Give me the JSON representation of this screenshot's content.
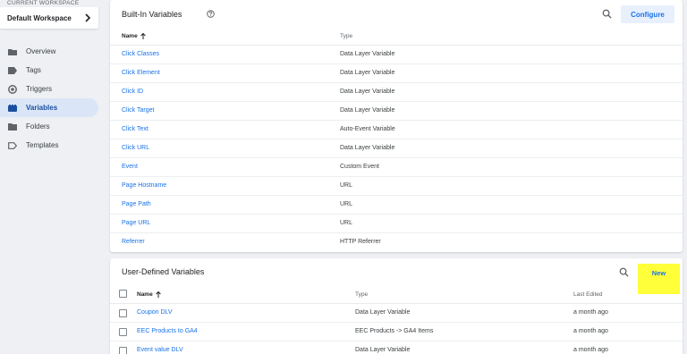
{
  "sidebar": {
    "workspace_label": "CURRENT WORKSPACE",
    "workspace_name": "Default Workspace",
    "items": [
      {
        "label": "Overview",
        "icon": "folder-icon"
      },
      {
        "label": "Tags",
        "icon": "tag-icon"
      },
      {
        "label": "Triggers",
        "icon": "trigger-icon"
      },
      {
        "label": "Variables",
        "icon": "variables-icon",
        "active": true
      },
      {
        "label": "Folders",
        "icon": "folder-icon"
      },
      {
        "label": "Templates",
        "icon": "template-icon"
      }
    ]
  },
  "builtin": {
    "title": "Built-In Variables",
    "configure_label": "Configure",
    "columns": {
      "name": "Name",
      "type": "Type"
    },
    "rows": [
      {
        "name": "Click Classes",
        "type": "Data Layer Variable"
      },
      {
        "name": "Click Element",
        "type": "Data Layer Variable"
      },
      {
        "name": "Click ID",
        "type": "Data Layer Variable"
      },
      {
        "name": "Click Target",
        "type": "Data Layer Variable"
      },
      {
        "name": "Click Text",
        "type": "Auto-Event Variable"
      },
      {
        "name": "Click URL",
        "type": "Data Layer Variable"
      },
      {
        "name": "Event",
        "type": "Custom Event"
      },
      {
        "name": "Page Hostname",
        "type": "URL"
      },
      {
        "name": "Page Path",
        "type": "URL"
      },
      {
        "name": "Page URL",
        "type": "URL"
      },
      {
        "name": "Referrer",
        "type": "HTTP Referrer"
      }
    ]
  },
  "user_defined": {
    "title": "User-Defined Variables",
    "new_label": "New",
    "columns": {
      "name": "Name",
      "type": "Type",
      "last_edited": "Last Edited"
    },
    "rows": [
      {
        "name": "Coupon DLV",
        "type": "Data Layer Variable",
        "last_edited": "a month ago"
      },
      {
        "name": "EEC Products to GA4",
        "type": "EEC Products -> GA4 Items",
        "last_edited": "a month ago"
      },
      {
        "name": "Event value DLV",
        "type": "Data Layer Variable",
        "last_edited": "a month ago"
      }
    ]
  },
  "colors": {
    "accent": "#1a73e8",
    "highlight": "#ffff3a",
    "active_nav": "#dae6f7"
  }
}
